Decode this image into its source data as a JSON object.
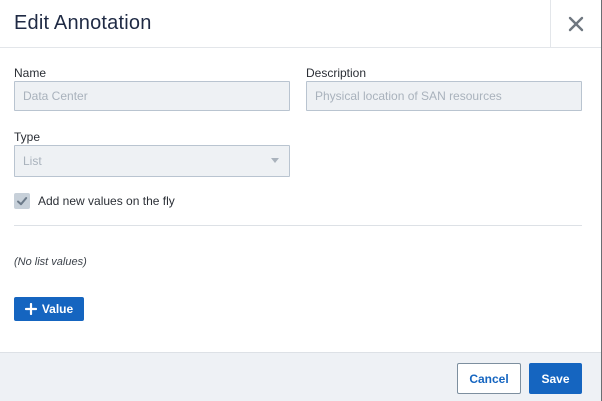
{
  "dialog": {
    "title": "Edit Annotation"
  },
  "form": {
    "name": {
      "label": "Name",
      "value": "Data Center"
    },
    "description": {
      "label": "Description",
      "value": "Physical location of SAN resources"
    },
    "type": {
      "label": "Type",
      "value": "List"
    },
    "add_on_fly": {
      "label": "Add new values on the fly",
      "checked": true
    }
  },
  "list": {
    "empty_text": "(No list values)",
    "add_value_label": "Value"
  },
  "footer": {
    "cancel_label": "Cancel",
    "save_label": "Save"
  },
  "colors": {
    "primary": "#1565c0",
    "title": "#1f2a44",
    "field_bg": "#eef1f4",
    "field_border": "#b9c4d0",
    "footer_bg": "#eef1f5"
  },
  "icons": {
    "close": "close-icon",
    "checkbox": "checkmark-icon",
    "add": "plus-icon",
    "select": "caret-down-icon"
  }
}
